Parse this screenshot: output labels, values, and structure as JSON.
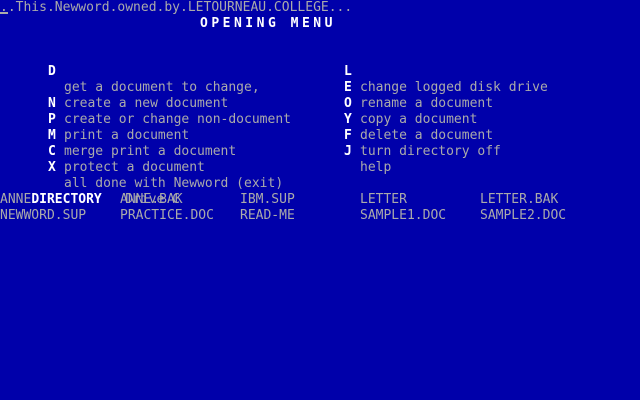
{
  "header": {
    "ownership_line": "..This.Newword.owned.by.LETOURNEAU.COLLEGE...",
    "menu_title": "OPENING MENU"
  },
  "menu": {
    "left": [
      {
        "key": "D",
        "label": "get a document to change,"
      },
      {
        "key": "",
        "label": "create a new document"
      },
      {
        "key": "N",
        "label": "create or change non-document"
      },
      {
        "key": "P",
        "label": "print a document"
      },
      {
        "key": "M",
        "label": "merge print a document"
      },
      {
        "key": "C",
        "label": "protect a document"
      },
      {
        "key": "X",
        "label": "all done with Newword (exit)"
      }
    ],
    "right": [
      {
        "key": "L",
        "label": "change logged disk drive"
      },
      {
        "key": "E",
        "label": "rename a document"
      },
      {
        "key": "O",
        "label": "copy a document"
      },
      {
        "key": "Y",
        "label": "delete a document"
      },
      {
        "key": "F",
        "label": "turn directory off"
      },
      {
        "key": "J",
        "label": "help"
      }
    ]
  },
  "directory": {
    "label": "DIRECTORY",
    "drive": "Drive C",
    "files": [
      "ANNE",
      "ANNE.BAK",
      "IBM.SUP",
      "LETTER",
      "LETTER.BAK",
      "NEWWORD.SUP",
      "PRACTICE.DOC",
      "READ-ME",
      "SAMPLE1.DOC",
      "SAMPLE2.DOC"
    ]
  },
  "colors": {
    "background": "#0000aa",
    "text": "#aaaaaa",
    "highlight": "#ffffff"
  }
}
